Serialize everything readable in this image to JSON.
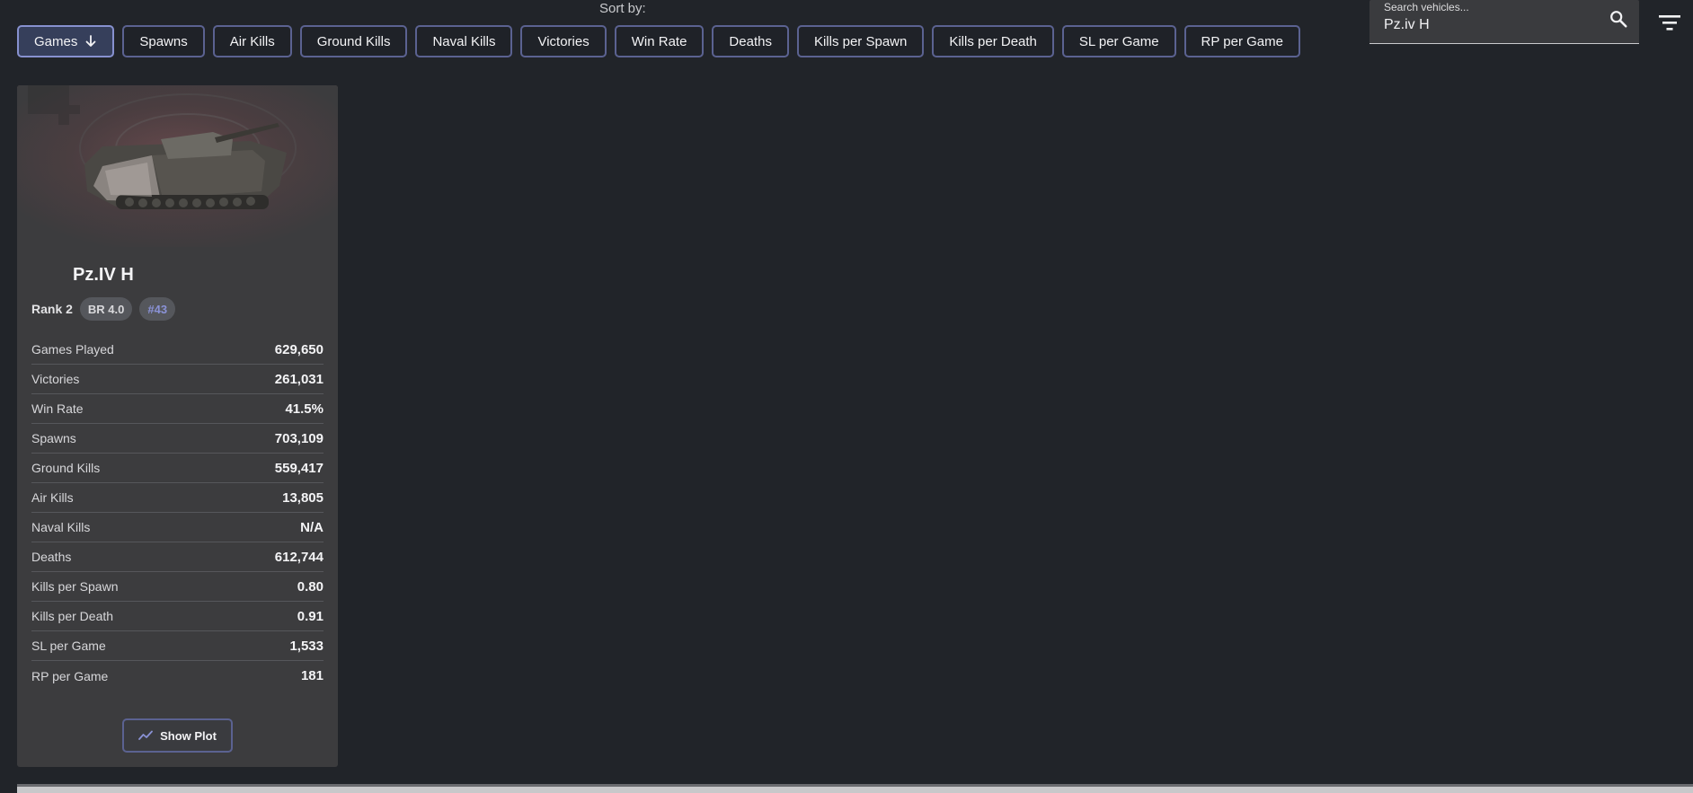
{
  "sort": {
    "label": "Sort by:",
    "buttons": [
      {
        "id": "games",
        "label": "Games",
        "active": true
      },
      {
        "id": "spawns",
        "label": "Spawns"
      },
      {
        "id": "air-kills",
        "label": "Air Kills"
      },
      {
        "id": "ground-kills",
        "label": "Ground Kills"
      },
      {
        "id": "naval-kills",
        "label": "Naval Kills"
      },
      {
        "id": "victories",
        "label": "Victories"
      },
      {
        "id": "win-rate",
        "label": "Win Rate"
      },
      {
        "id": "deaths",
        "label": "Deaths"
      },
      {
        "id": "kills-per-spawn",
        "label": "Kills per Spawn"
      },
      {
        "id": "kills-per-death",
        "label": "Kills per Death"
      },
      {
        "id": "sl-per-game",
        "label": "SL per Game"
      },
      {
        "id": "rp-per-game",
        "label": "RP per Game"
      }
    ],
    "active_icon": "arrow-down-icon"
  },
  "search": {
    "label": "Search vehicles...",
    "value": "Pz.iv H",
    "icon": "search-icon"
  },
  "filter_icon": "filter-icon",
  "vehicle": {
    "name": "Pz.IV H",
    "rank": "Rank 2",
    "br": "BR 4.0",
    "position": "#43",
    "stats": [
      {
        "label": "Games Played",
        "value": "629,650"
      },
      {
        "label": "Victories",
        "value": "261,031"
      },
      {
        "label": "Win Rate",
        "value": "41.5%"
      },
      {
        "label": "Spawns",
        "value": "703,109"
      },
      {
        "label": "Ground Kills",
        "value": "559,417"
      },
      {
        "label": "Air Kills",
        "value": "13,805"
      },
      {
        "label": "Naval Kills",
        "value": "N/A"
      },
      {
        "label": "Deaths",
        "value": "612,744"
      },
      {
        "label": "Kills per Spawn",
        "value": "0.80"
      },
      {
        "label": "Kills per Death",
        "value": "0.91"
      },
      {
        "label": "SL per Game",
        "value": "1,533"
      },
      {
        "label": "RP per Game",
        "value": "181"
      }
    ],
    "plot_button": "Show Plot",
    "plot_icon": "trend-line-icon"
  },
  "colors": {
    "background": "#212429",
    "card": "#3c3c3e",
    "accent_border": "#5b6291",
    "accent_text": "#8a92d6"
  }
}
